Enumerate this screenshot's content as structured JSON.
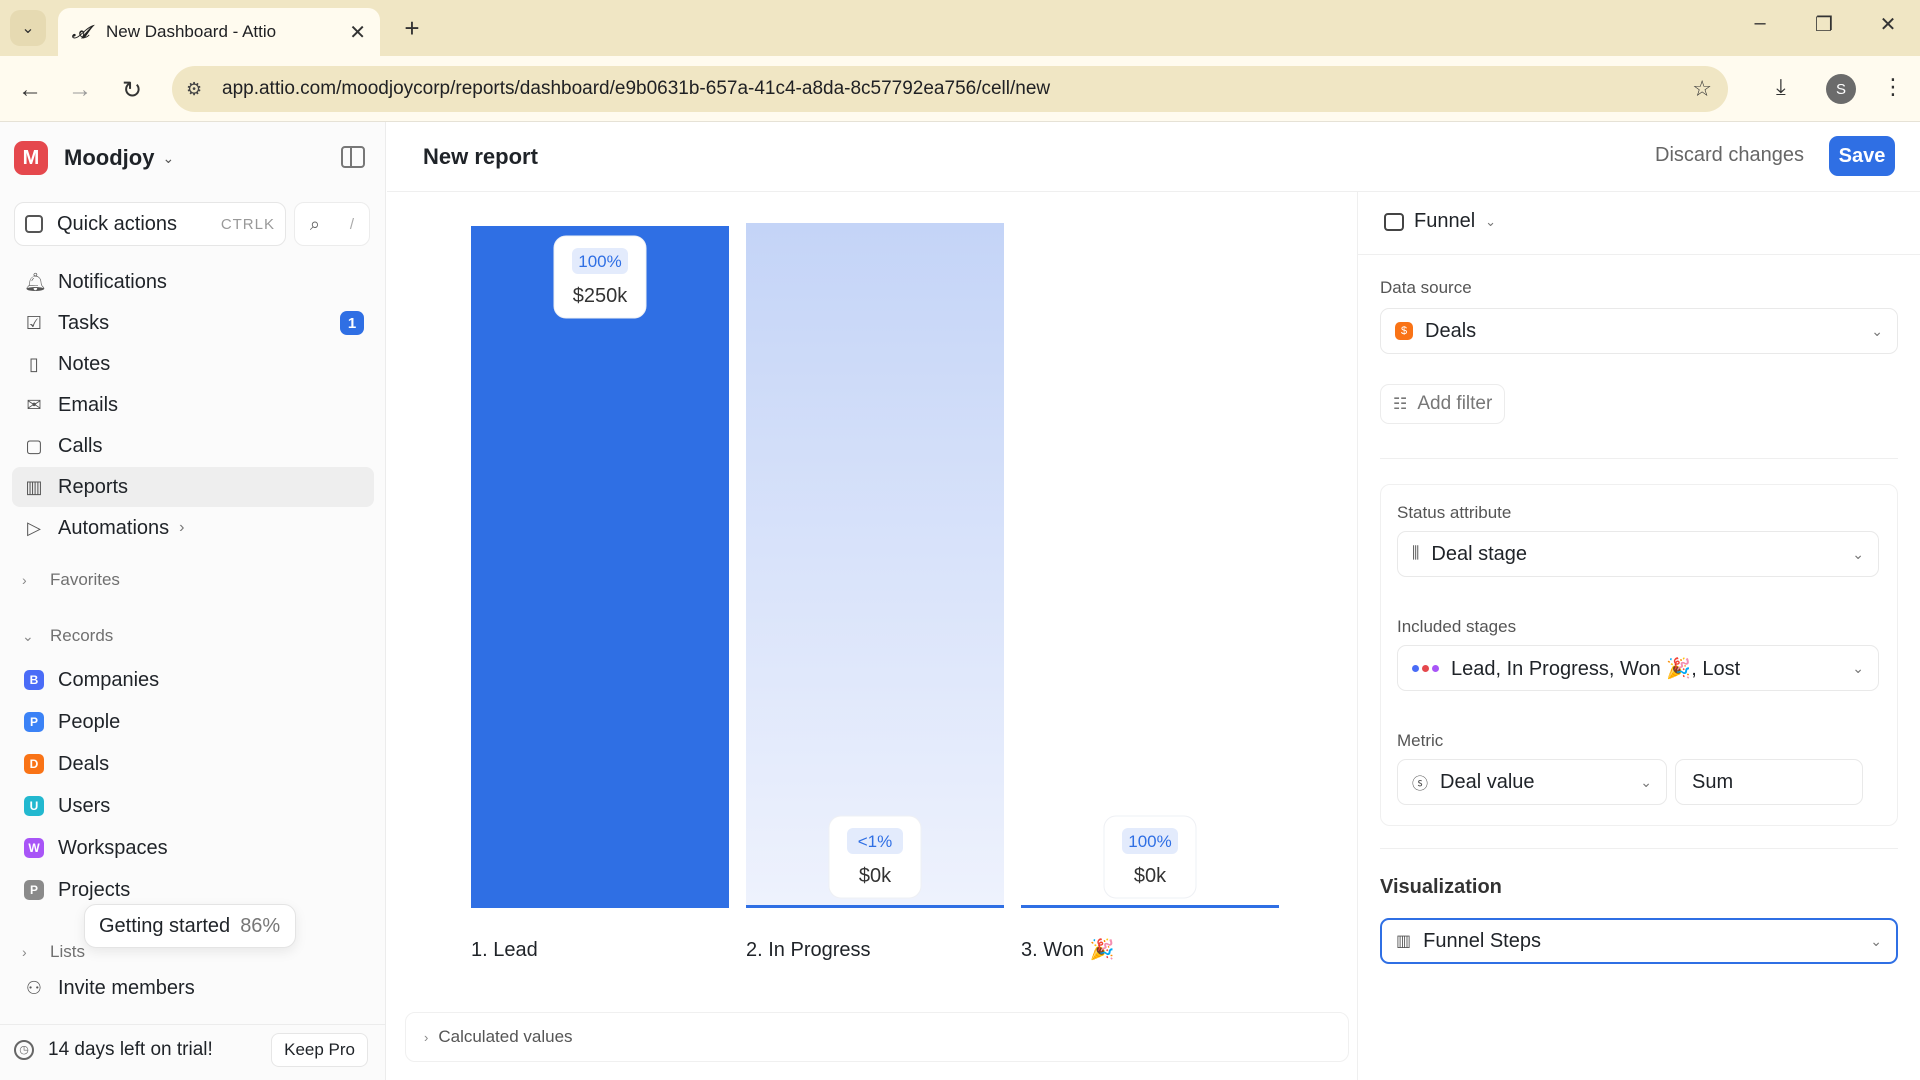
{
  "browser": {
    "tab_title": "New Dashboard - Attio",
    "url": "app.attio.com/moodjoycorp/reports/dashboard/e9b0631b-657a-41c4-a8da-8c57792ea756/cell/new",
    "profile_initial": "S"
  },
  "sidebar": {
    "workspace_initial": "M",
    "workspace_name": "Moodjoy",
    "quick_actions": {
      "label": "Quick actions",
      "shortcut": "CTRLK",
      "search_shortcut": "/"
    },
    "nav": [
      {
        "label": "Notifications",
        "icon": "bell-icon"
      },
      {
        "label": "Tasks",
        "icon": "checkbox-icon",
        "badge": "1"
      },
      {
        "label": "Notes",
        "icon": "note-icon"
      },
      {
        "label": "Emails",
        "icon": "mail-icon"
      },
      {
        "label": "Calls",
        "icon": "call-icon"
      },
      {
        "label": "Reports",
        "icon": "chart-icon",
        "active": true
      },
      {
        "label": "Automations",
        "icon": "play-icon"
      }
    ],
    "favorites_label": "Favorites",
    "records_label": "Records",
    "records": [
      {
        "label": "Companies",
        "icon_letter": "B",
        "color": "#4a6cf7"
      },
      {
        "label": "People",
        "icon_letter": "P",
        "color": "#3b82f6"
      },
      {
        "label": "Deals",
        "icon_letter": "D",
        "color": "#f97316"
      },
      {
        "label": "Users",
        "icon_letter": "U",
        "color": "#22b8cf"
      },
      {
        "label": "Workspaces",
        "icon_letter": "W",
        "color": "#a855f7"
      },
      {
        "label": "Projects",
        "icon_letter": "P",
        "color": "#8a8a8a"
      }
    ],
    "lists_label": "Lists",
    "invite_label": "Invite members",
    "getting_started": {
      "label": "Getting started",
      "percent": "86%"
    },
    "trial": {
      "text": "14 days left on trial!",
      "button": "Keep Pro"
    }
  },
  "header": {
    "title": "New report",
    "discard_label": "Discard changes",
    "save_label": "Save"
  },
  "chart_data": {
    "type": "bar",
    "subtype": "funnel",
    "categories": [
      "1. Lead",
      "2. In Progress",
      "3. Won 🎉"
    ],
    "values": [
      250,
      0,
      0
    ],
    "value_unit": "$k",
    "labels": [
      {
        "percent": "100%",
        "value": "$250k"
      },
      {
        "percent": "<1%",
        "value": "$0k"
      },
      {
        "percent": "100%",
        "value": "$0k"
      }
    ],
    "colors": {
      "primary": "#2f6fe4",
      "dropoff_top": "#c4d4f7",
      "dropoff_bottom": "#eef2fd"
    },
    "calculated_values_label": "Calculated values"
  },
  "panel": {
    "viz_type": "Funnel",
    "data_source_label": "Data source",
    "data_source_value": "Deals",
    "add_filter_label": "Add filter",
    "status_attribute_label": "Status attribute",
    "status_attribute_value": "Deal stage",
    "included_stages_label": "Included stages",
    "included_stages_value": "Lead, In Progress, Won 🎉, Lost",
    "metric_label": "Metric",
    "metric_value": "Deal value",
    "metric_agg": "Sum",
    "visualization_label": "Visualization",
    "visualization_value": "Funnel Steps"
  }
}
